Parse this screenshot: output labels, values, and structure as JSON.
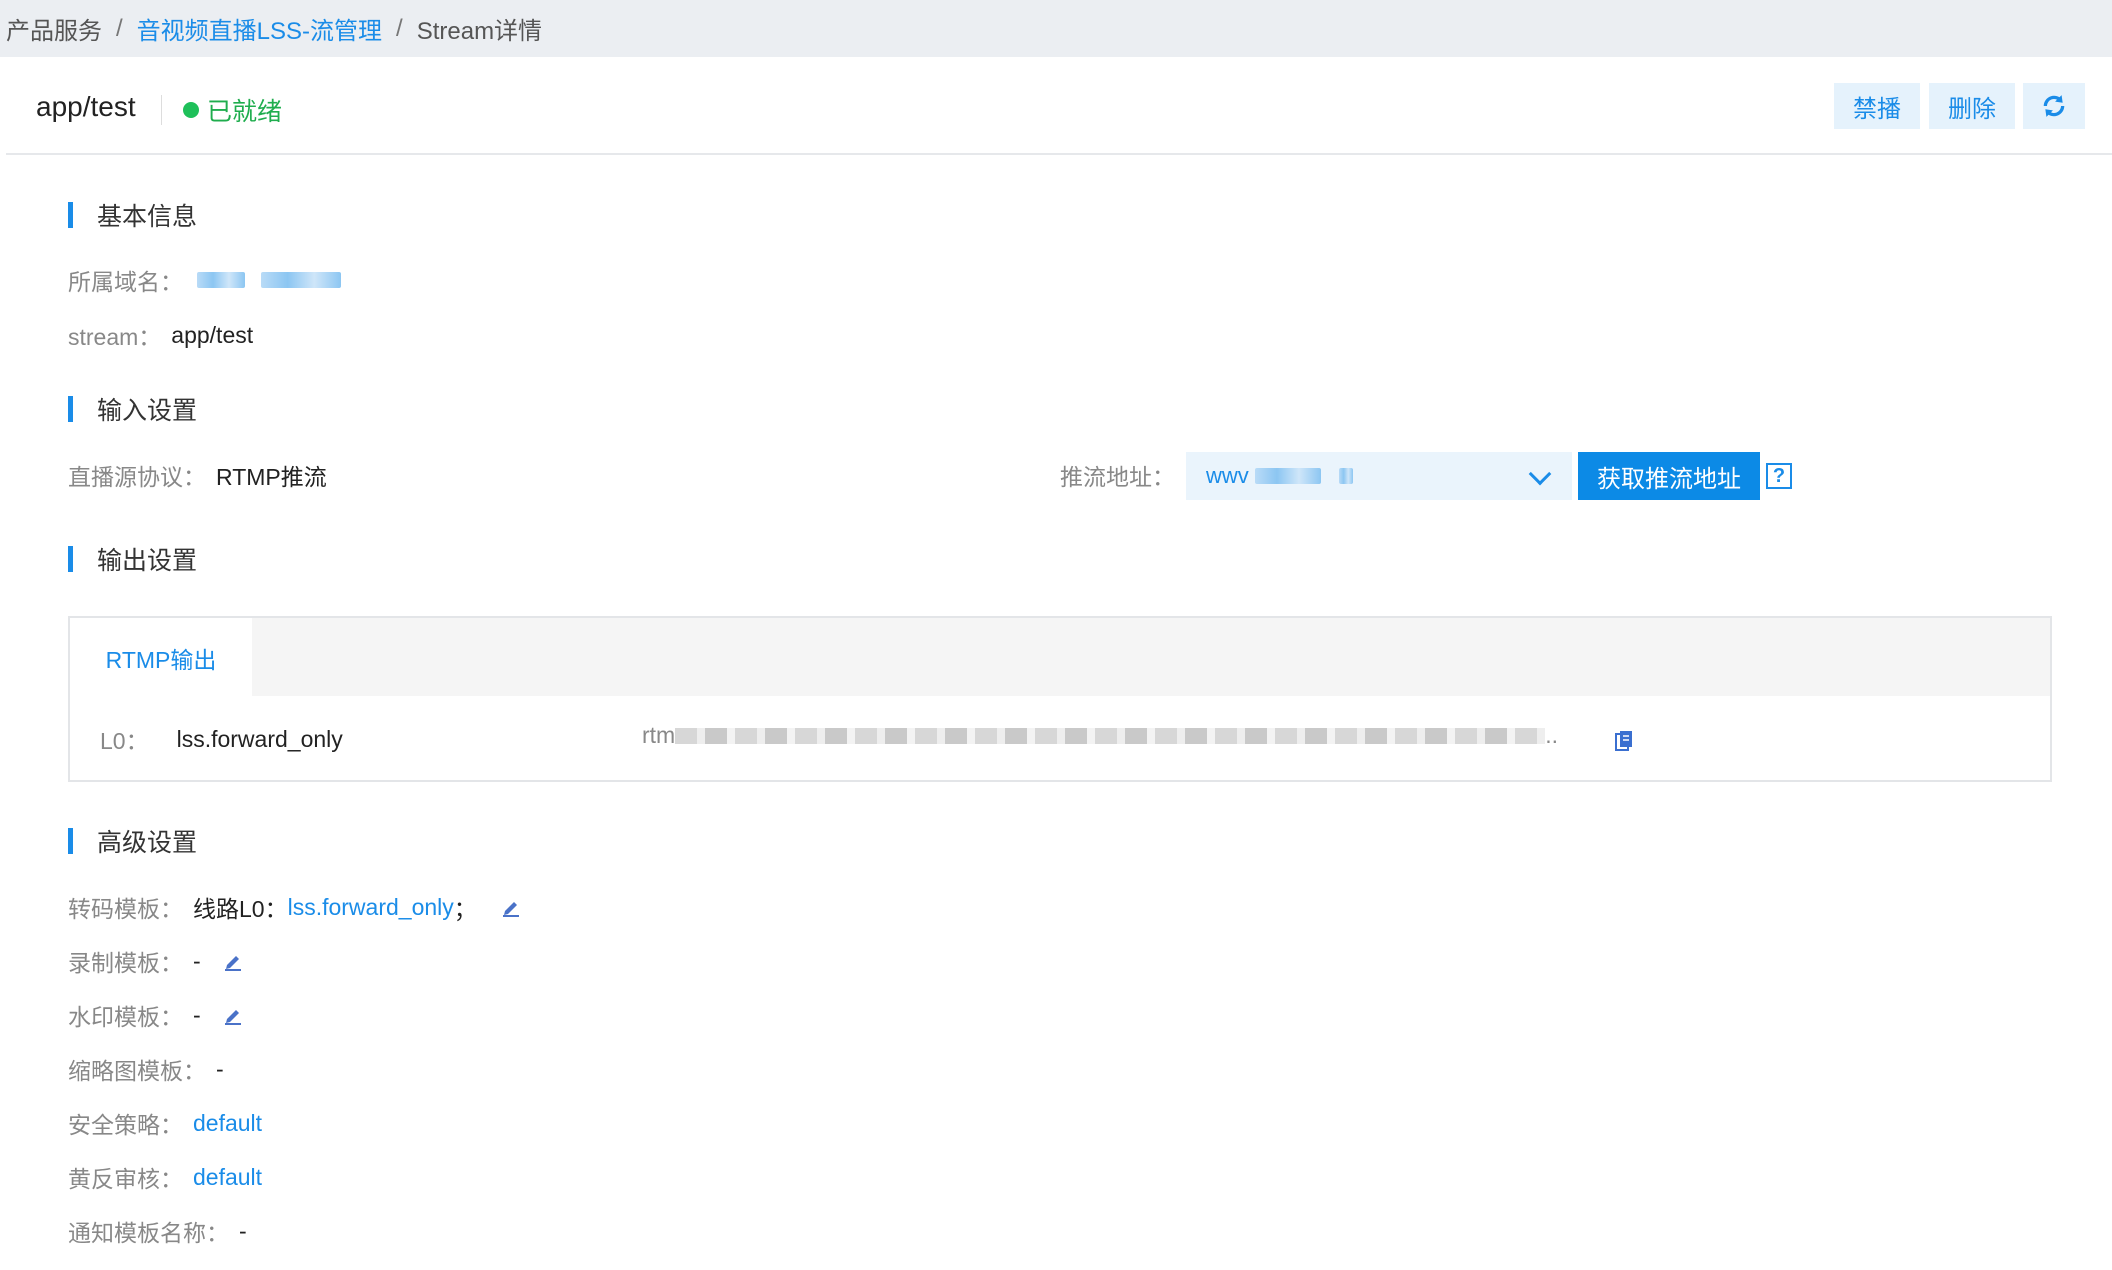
{
  "breadcrumb": {
    "items": [
      "产品服务",
      "音视频直播LSS-流管理",
      "Stream详情"
    ],
    "separator": "/"
  },
  "header": {
    "title": "app/test",
    "status": "已就绪",
    "buttons": {
      "ban": "禁播",
      "delete": "删除",
      "refresh_icon": "refresh-icon"
    }
  },
  "basic": {
    "title": "基本信息",
    "domain_label": "所属域名：",
    "stream_label": "stream：",
    "stream_value": "app/test"
  },
  "input": {
    "title": "输入设置",
    "protocol_label": "直播源协议：",
    "protocol_value": "RTMP推流",
    "push_label": "推流地址：",
    "push_select_prefix": "wwv",
    "get_push_button": "获取推流地址",
    "help": "?"
  },
  "output": {
    "title": "输出设置",
    "tab": "RTMP输出",
    "row_label": "L0：",
    "row_template": "lss.forward_only",
    "row_url_prefix": "rtm",
    "row_url_suffix": ".."
  },
  "advanced": {
    "title": "高级设置",
    "transcode_label": "转码模板：",
    "transcode_prefix": "线路L0：",
    "transcode_link": "lss.forward_only",
    "transcode_suffix": "；",
    "record_label": "录制模板：",
    "record_value": "-",
    "watermark_label": "水印模板：",
    "watermark_value": "-",
    "thumbnail_label": "缩略图模板：",
    "thumbnail_value": "-",
    "security_label": "安全策略：",
    "security_value": "default",
    "porn_label": "黄反审核：",
    "porn_value": "default",
    "notify_label": "通知模板名称：",
    "notify_value": "-"
  },
  "colors": {
    "accent": "#1a8ce8",
    "success": "#1fad4e",
    "breadcrumb_bg": "#ebeef2"
  }
}
